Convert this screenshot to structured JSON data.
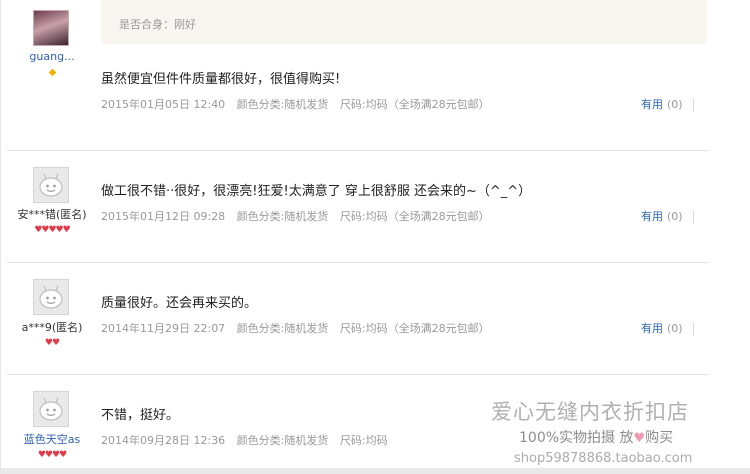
{
  "reviews": [
    {
      "username": "guang...",
      "fit_label": "是否合身：刚好",
      "comment": "虽然便宜但件件质量都很好，很值得购买!",
      "date": "2015年01月05日 12:40",
      "color": "颜色分类:随机发货",
      "size": "尺码:均码（全场满28元包邮）",
      "useful_label": "有用",
      "useful_count": "(0)",
      "badge": "gold"
    },
    {
      "username": "安***错(匿名)",
      "comment": "做工很不错··很好，很漂亮!狂爱!太满意了 穿上很舒服 还会来的~（^_^）",
      "date": "2015年01月12日 09:28",
      "color": "颜色分类:随机发货",
      "size": "尺码:均码（全场满28元包邮）",
      "useful_label": "有用",
      "useful_count": "(0)",
      "badge_hearts": 5
    },
    {
      "username": "a***9(匿名)",
      "comment": "质量很好。还会再来买的。",
      "date": "2014年11月29日 22:07",
      "color": "颜色分类:随机发货",
      "size": "尺码:均码（全场满28元包邮）",
      "useful_label": "有用",
      "useful_count": "(0)",
      "badge_hearts": 2
    },
    {
      "username": "蓝色天空as",
      "comment": "不错，挺好。",
      "date": "2014年09月28日 12:36",
      "color": "颜色分类:随机发货",
      "size": "尺码:均码",
      "badge_hearts": 4
    }
  ],
  "watermark": {
    "shop_name": "爱心无缝内衣折扣店",
    "slogan_a": "100%实物拍摄  放",
    "slogan_b": "购买",
    "url": "shop59878868.taobao.com"
  },
  "colors": {
    "link": "#2d64b3",
    "heart": "#e03b4b",
    "meta": "#999999"
  }
}
